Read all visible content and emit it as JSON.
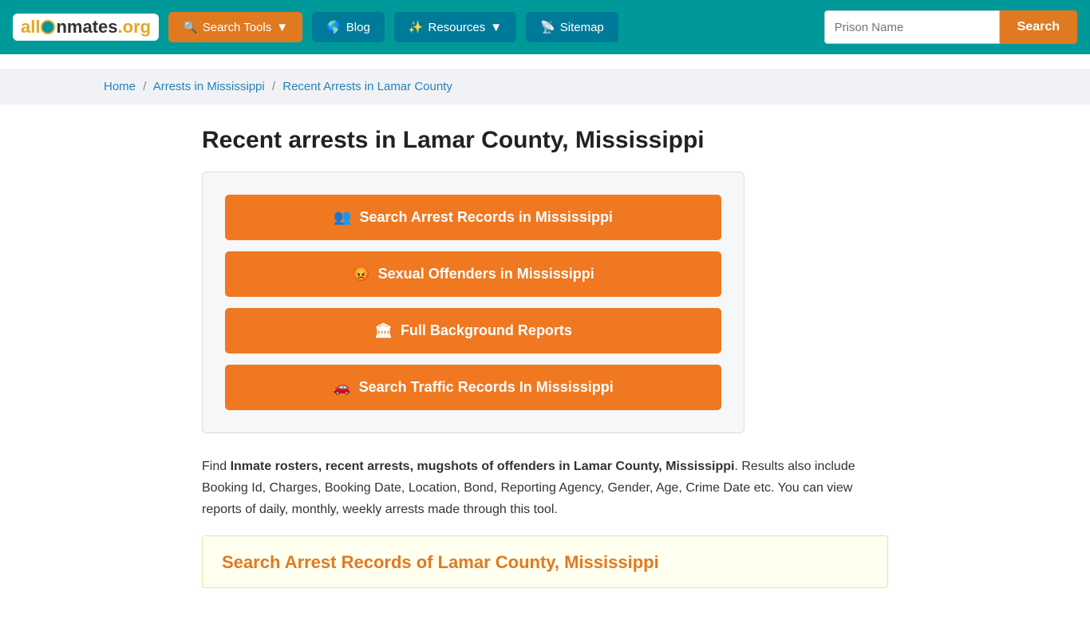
{
  "navbar": {
    "logo": {
      "text_all": "all",
      "text_inmates": "Inmates",
      "text_org": ".org"
    },
    "search_tools_label": "Search Tools",
    "blog_label": "Blog",
    "resources_label": "Resources",
    "sitemap_label": "Sitemap",
    "search_placeholder": "Prison Name",
    "search_button": "Search"
  },
  "breadcrumb": {
    "home": "Home",
    "arrests": "Arrests in Mississippi",
    "current": "Recent Arrests in Lamar County"
  },
  "page_title": "Recent arrests in Lamar County, Mississippi",
  "card": {
    "btn1_label": "Search Arrest Records in Mississippi",
    "btn2_label": "Sexual Offenders in Mississippi",
    "btn3_label": "Full Background Reports",
    "btn4_label": "Search Traffic Records In Mississippi"
  },
  "description": {
    "intro": "Find ",
    "bold": "Inmate rosters, recent arrests, mugshots of offenders in Lamar County, Mississippi",
    "rest": ". Results also include Booking Id, Charges, Booking Date, Location, Bond, Reporting Agency, Gender, Age, Crime Date etc. You can view reports of daily, monthly, weekly arrests made through this tool."
  },
  "section_box": {
    "title": "Search Arrest Records of Lamar County, Mississippi"
  }
}
